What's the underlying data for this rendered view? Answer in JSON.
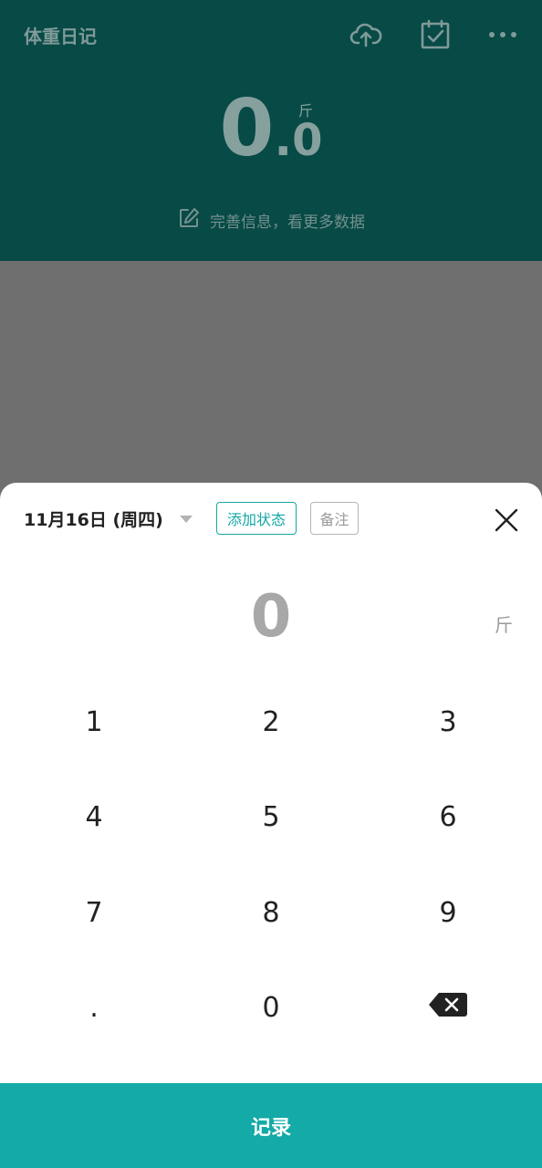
{
  "app": {
    "title": "体重日记",
    "weight_int": "0",
    "weight_dot": ".",
    "weight_dec": "0",
    "unit": "斤",
    "info_link": "完善信息，看更多数据",
    "icons": [
      "cloud-upload-icon",
      "calendar-check-icon",
      "more-icon"
    ]
  },
  "sheet": {
    "date": "11月16日 (周四)",
    "add_status": "添加状态",
    "note": "备注",
    "entry_value": "0",
    "entry_unit": "斤",
    "keys": [
      "1",
      "2",
      "3",
      "4",
      "5",
      "6",
      "7",
      "8",
      "9",
      ".",
      "0"
    ],
    "record": "记录"
  },
  "colors": {
    "accent": "#14aaa7",
    "header_dimmed": "#074a46",
    "overlay": "#6f6f6f"
  }
}
